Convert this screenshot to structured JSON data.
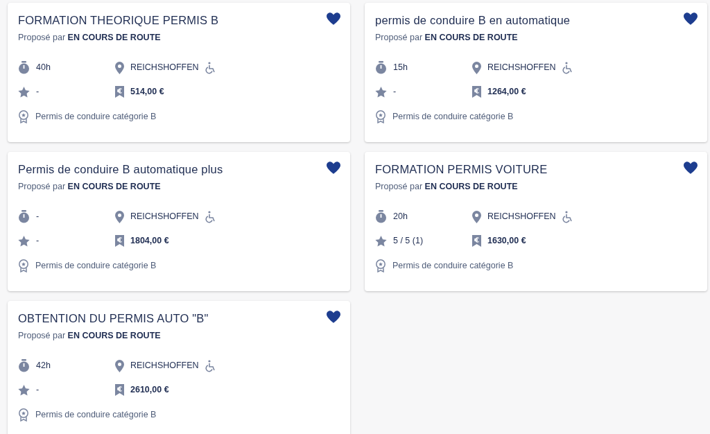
{
  "trainings": [
    {
      "title": "FORMATION THEORIQUE PERMIS B",
      "favorite": true,
      "provider": "Proposé par **EN COURS DE ROUTE**",
      "duration": "40h",
      "location": "REICHSHOFFEN",
      "accessible": true,
      "rating": "-",
      "price": "514,00 €",
      "certification": "Permis de conduire catégorie B"
    },
    {
      "title": "permis de conduire B en automatique",
      "favorite": true,
      "provider": "Proposé par **EN COURS DE ROUTE**",
      "duration": "15h",
      "location": "REICHSHOFFEN",
      "accessible": true,
      "rating": "-",
      "price": "1264,00 €",
      "certification": "Permis de conduire catégorie B"
    },
    {
      "title": "Permis de conduire B automatique plus",
      "favorite": true,
      "provider": "Proposé par **EN COURS DE ROUTE**",
      "duration": "-",
      "location": "REICHSHOFFEN",
      "accessible": true,
      "rating": "-",
      "price": "1804,00 €",
      "certification": "Permis de conduire catégorie B"
    },
    {
      "title": "FORMATION PERMIS VOITURE",
      "favorite": true,
      "provider": "Proposé par **EN COURS DE ROUTE**",
      "duration": "20h",
      "location": "REICHSHOFFEN",
      "accessible": true,
      "rating": "5 / 5 (1)",
      "price": "1630,00 €",
      "certification": "Permis de conduire catégorie B"
    },
    {
      "title": "OBTENTION DU PERMIS AUTO \"B\"",
      "favorite": true,
      "provider": "Proposé par **EN COURS DE ROUTE**",
      "duration": "42h",
      "location": "REICHSHOFFEN",
      "accessible": true,
      "rating": "-",
      "price": "2610,00 €",
      "certification": "Permis de conduire catégorie B"
    }
  ]
}
